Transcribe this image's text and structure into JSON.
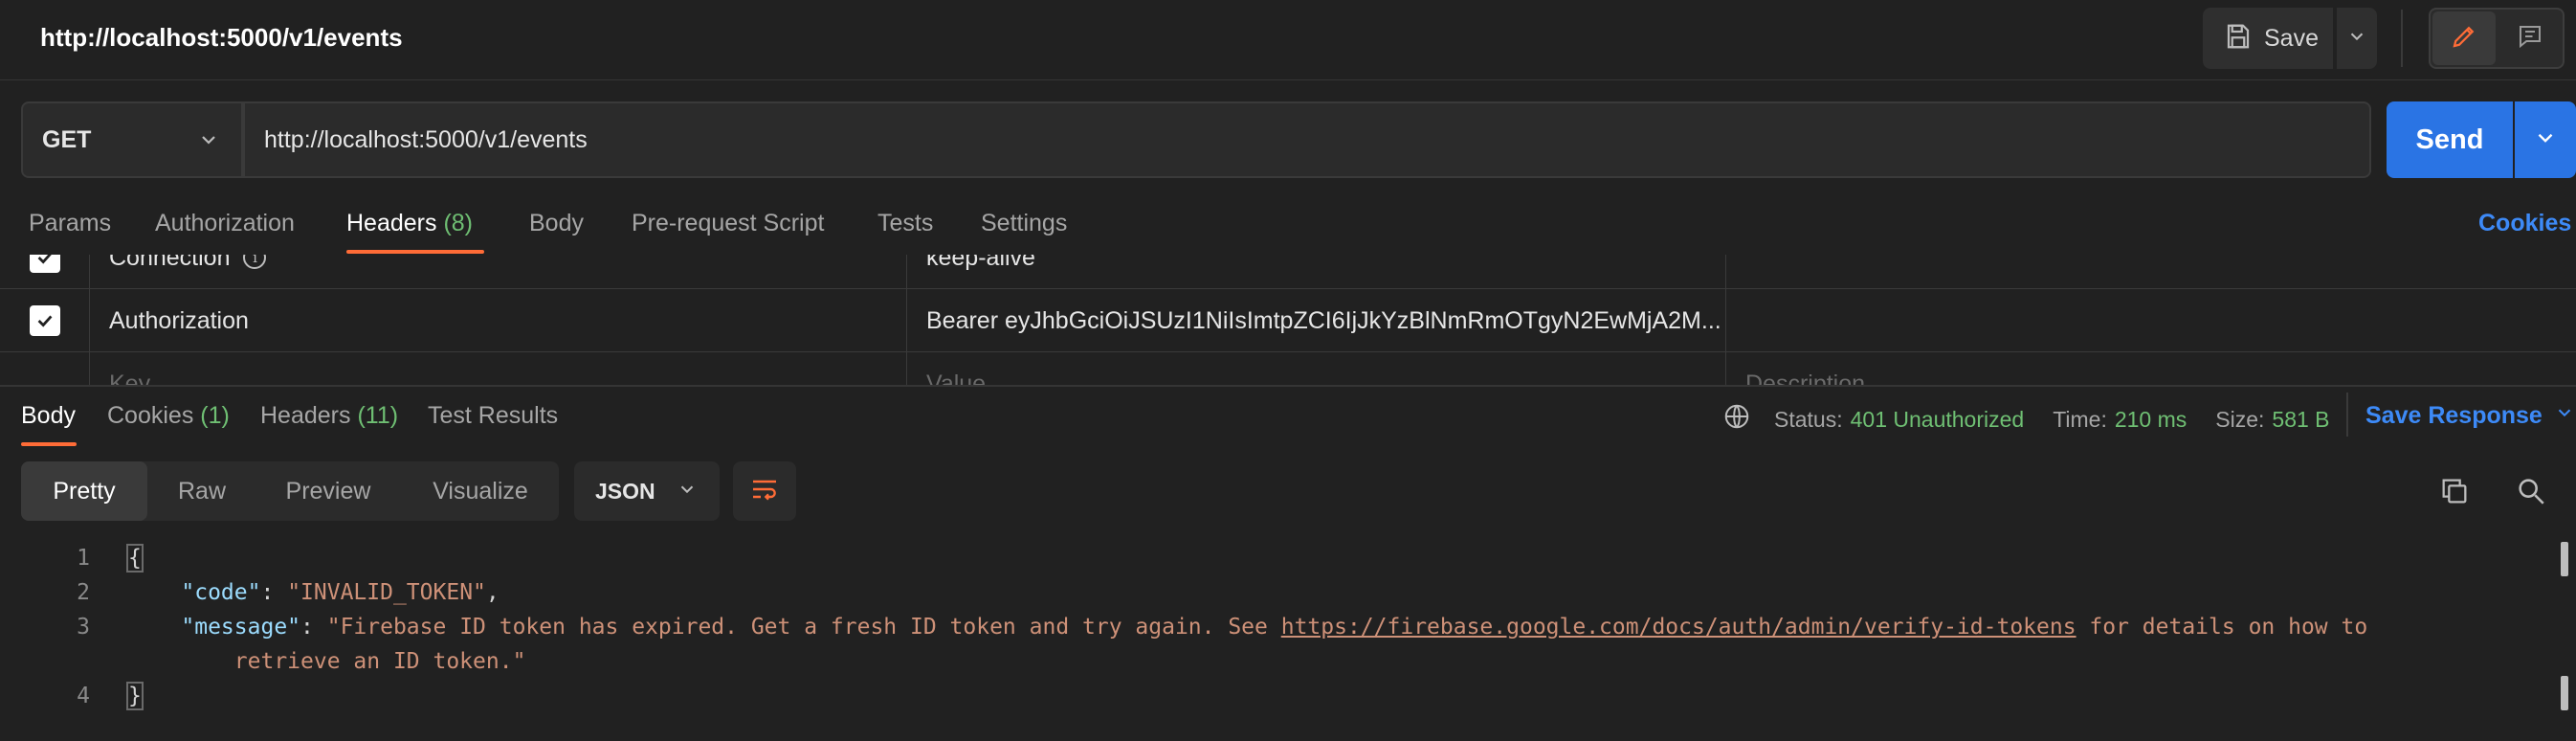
{
  "window": {
    "title": "http://localhost:5000/v1/events"
  },
  "toolbar": {
    "save_label": "Save"
  },
  "request": {
    "method": "GET",
    "url": "http://localhost:5000/v1/events",
    "send_label": "Send"
  },
  "request_tabs": [
    {
      "label": "Params"
    },
    {
      "label": "Authorization"
    },
    {
      "label": "Headers",
      "count": "(8)"
    },
    {
      "label": "Body"
    },
    {
      "label": "Pre-request Script"
    },
    {
      "label": "Tests"
    },
    {
      "label": "Settings"
    }
  ],
  "cookies_link": "Cookies",
  "headers": {
    "rows": [
      {
        "key": "Connection",
        "value": "keep-alive",
        "checked": true
      },
      {
        "key": "Authorization",
        "value": "Bearer eyJhbGciOiJSUzI1NiIsImtpZCI6IjJkYzBlNmRmOTgyN2EwMjA2M...",
        "checked": true
      }
    ],
    "placeholders": {
      "key": "Key",
      "value": "Value",
      "description": "Description"
    }
  },
  "response_tabs": [
    {
      "label": "Body"
    },
    {
      "label": "Cookies",
      "count": "(1)"
    },
    {
      "label": "Headers",
      "count": "(11)"
    },
    {
      "label": "Test Results"
    }
  ],
  "response_meta": {
    "status_label": "Status:",
    "status_value": "401 Unauthorized",
    "time_label": "Time:",
    "time_value": "210 ms",
    "size_label": "Size:",
    "size_value": "581 B",
    "save_response_label": "Save Response"
  },
  "body_views": [
    "Pretty",
    "Raw",
    "Preview",
    "Visualize"
  ],
  "format": "JSON",
  "code": {
    "line_numbers": [
      "1",
      "2",
      "3",
      "4"
    ],
    "open_brace": "{",
    "close_brace": "}",
    "code_key": "\"code\"",
    "code_value": "\"INVALID_TOKEN\"",
    "message_key": "\"message\"",
    "message_value_start": "\"Firebase ID token has expired. Get a fresh ID token and try again. See ",
    "message_link": "https://firebase.google.com/docs/auth/admin/verify-id-tokens",
    "message_value_end": " for details on how to",
    "message_value_wrap": "retrieve an ID token.\""
  },
  "colors": {
    "accent_orange": "#ff6c37",
    "send_blue": "#2a74e4",
    "link_blue": "#3d8af7",
    "count_green": "#6fbf73"
  }
}
